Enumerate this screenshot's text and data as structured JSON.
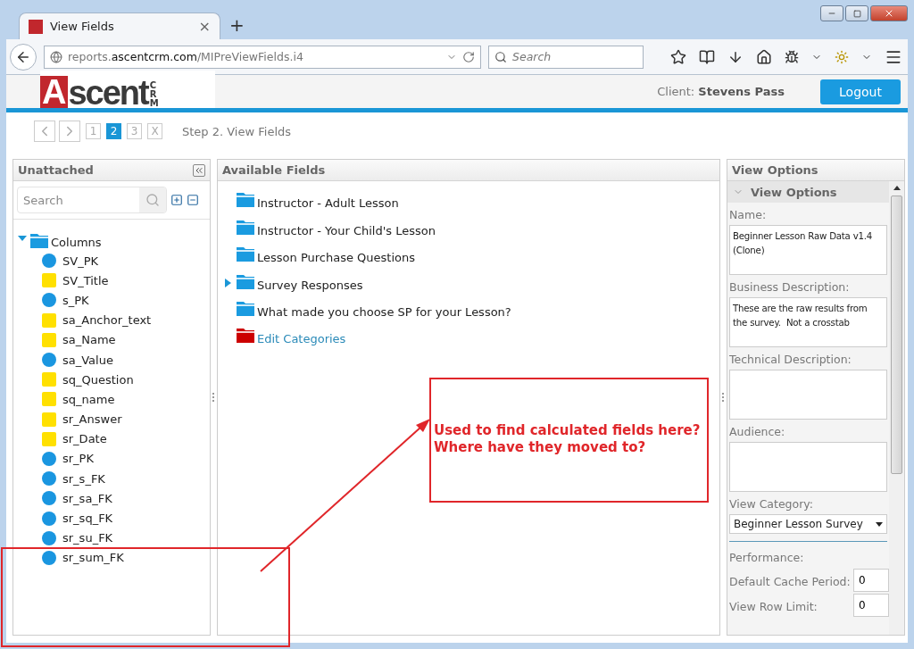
{
  "browser": {
    "tab_title": "View Fields",
    "tab_close": "×",
    "new_tab": "+",
    "url": "reports.**ascentcrm.com**/MIPreViewFields.i4",
    "search_placeholder": "Search"
  },
  "header": {
    "logo_initial": "A",
    "logo_rest": "scent",
    "logo_suffix": "CRM",
    "client_label": "Client:",
    "client_name": "Stevens Pass",
    "logout": "Logout"
  },
  "steps": {
    "pages": [
      {
        "label": "1",
        "selected": false
      },
      {
        "label": "2",
        "selected": true
      },
      {
        "label": "3",
        "selected": false
      },
      {
        "label": "X",
        "selected": false
      }
    ],
    "title": "Step 2. View Fields"
  },
  "unattached": {
    "title": "Unattached",
    "search_placeholder": "Search",
    "root": {
      "label": "Columns",
      "expanded": true,
      "children": [
        {
          "label": "SV_PK",
          "kind": "dot"
        },
        {
          "label": "SV_Title",
          "kind": "square"
        },
        {
          "label": "s_PK",
          "kind": "dot"
        },
        {
          "label": "sa_Anchor_text",
          "kind": "square"
        },
        {
          "label": "sa_Name",
          "kind": "square"
        },
        {
          "label": "sa_Value",
          "kind": "dot"
        },
        {
          "label": "sq_Question",
          "kind": "square"
        },
        {
          "label": "sq_name",
          "kind": "square"
        },
        {
          "label": "sr_Answer",
          "kind": "square"
        },
        {
          "label": "sr_Date",
          "kind": "square"
        },
        {
          "label": "sr_PK",
          "kind": "dot"
        },
        {
          "label": "sr_s_FK",
          "kind": "dot"
        },
        {
          "label": "sr_sa_FK",
          "kind": "dot"
        },
        {
          "label": "sr_sq_FK",
          "kind": "dot"
        },
        {
          "label": "sr_su_FK",
          "kind": "dot"
        },
        {
          "label": "sr_sum_FK",
          "kind": "dot"
        }
      ]
    }
  },
  "available_fields": {
    "title": "Available Fields",
    "items": [
      {
        "label": "Instructor - Adult Lesson",
        "kind": "folder",
        "expandable": false
      },
      {
        "label": "Instructor - Your Child's Lesson",
        "kind": "folder",
        "expandable": false
      },
      {
        "label": "Lesson Purchase Questions",
        "kind": "folder",
        "expandable": false
      },
      {
        "label": "Survey Responses",
        "kind": "folder",
        "expandable": true
      },
      {
        "label": "What made you choose SP for your Lesson?",
        "kind": "folder",
        "expandable": false
      },
      {
        "label": "Edit Categories",
        "kind": "link",
        "expandable": false
      }
    ]
  },
  "view_options": {
    "title": "View Options",
    "section_title": "View Options",
    "fields": [
      {
        "label": "Name:",
        "value": "Beginner Lesson Raw Data v1.4 (Clone)"
      },
      {
        "label": "Business Description:",
        "value": "These are the raw results from the survey.  Not a crosstab"
      },
      {
        "label": "Technical Description:"
      },
      {
        "label": "Audience:"
      }
    ],
    "category": {
      "label": "View Category:",
      "value": "Beginner Lesson Survey"
    },
    "performance": {
      "label": "Performance:",
      "rows": [
        {
          "label": "Default Cache Period:",
          "value": "0"
        },
        {
          "label": "View Row Limit:",
          "value": "0"
        }
      ]
    }
  },
  "annotation": {
    "lines": [
      "Used to find calculated fields here?",
      "Where have they moved to?"
    ]
  }
}
